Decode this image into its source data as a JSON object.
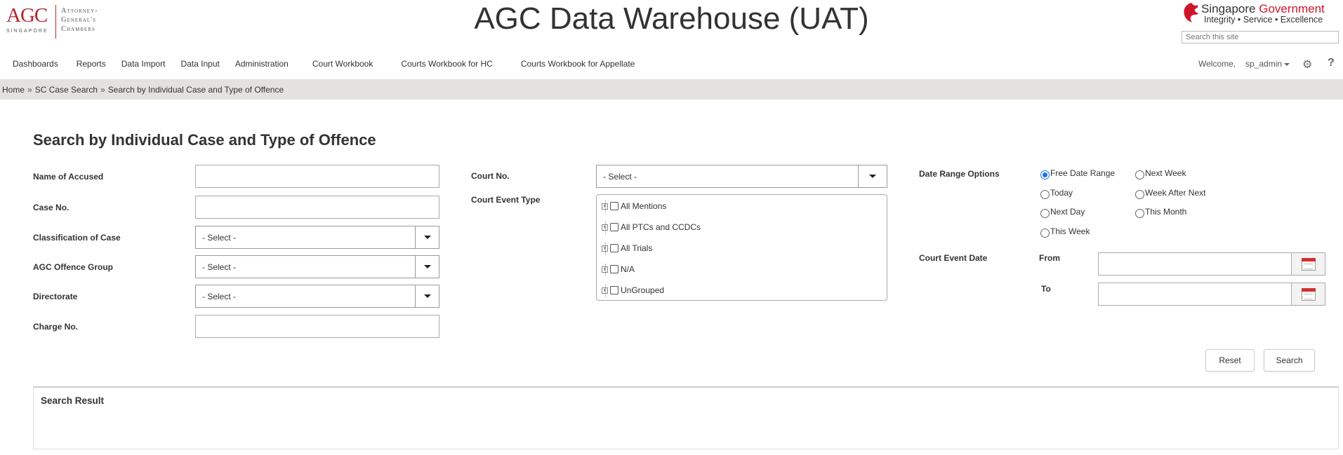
{
  "header": {
    "logo": {
      "mark": "AGC",
      "sub": "SINGAPORE",
      "line1": "Attorney-",
      "line2": "General's",
      "line3": "Chambers"
    },
    "title": "AGC Data Warehouse (UAT)",
    "sg": {
      "name_part1": "Singapore ",
      "name_part2": "Government",
      "tagline": "Integrity • Service • Excellence"
    },
    "search_placeholder": "Search this site"
  },
  "nav": {
    "items": [
      "Dashboards",
      "Reports",
      "Data Import",
      "Data Input",
      "Administration",
      "Court Workbook",
      "Courts Workbook for HC",
      "Courts Workbook for Appellate"
    ],
    "welcome": "Welcome,",
    "user": "sp_admin",
    "help": "?"
  },
  "breadcrumb": [
    "Home",
    "SC Case Search",
    "Search by Individual Case and Type of Offence"
  ],
  "breadcrumb_sep": "»",
  "page": {
    "title": "Search by Individual Case and Type of Offence"
  },
  "form": {
    "name_of_accused": {
      "label": "Name of Accused",
      "value": ""
    },
    "case_no": {
      "label": "Case No.",
      "value": ""
    },
    "classification": {
      "label": "Classification of Case",
      "value": "- Select -"
    },
    "offence_group": {
      "label": "AGC Offence Group",
      "value": "- Select -"
    },
    "directorate": {
      "label": "Directorate",
      "value": "- Select -"
    },
    "charge_no": {
      "label": "Charge No.",
      "value": ""
    },
    "court_no": {
      "label": "Court No.",
      "value": "- Select -"
    },
    "court_event_type": {
      "label": "Court Event Type",
      "items": [
        "All Mentions",
        "All PTCs and CCDCs",
        "All Trials",
        "N/A",
        "UnGrouped"
      ]
    },
    "date_range": {
      "label": "Date Range Options",
      "options": [
        "Free Date Range",
        "Next Week",
        "Today",
        "Week After Next",
        "Next Day",
        "This Month",
        "This Week"
      ],
      "selected": "Free Date Range"
    },
    "court_event_date": {
      "label": "Court Event Date",
      "from_label": "From",
      "to_label": "To",
      "from_value": "",
      "to_value": ""
    }
  },
  "buttons": {
    "reset": "Reset",
    "search": "Search"
  },
  "result": {
    "title": "Search Result"
  },
  "colors": {
    "brand_red": "#b3262e",
    "sg_red": "#d0152a",
    "breadcrumb_bg": "#e4e2df",
    "radio_accent": "#1a73e8"
  }
}
